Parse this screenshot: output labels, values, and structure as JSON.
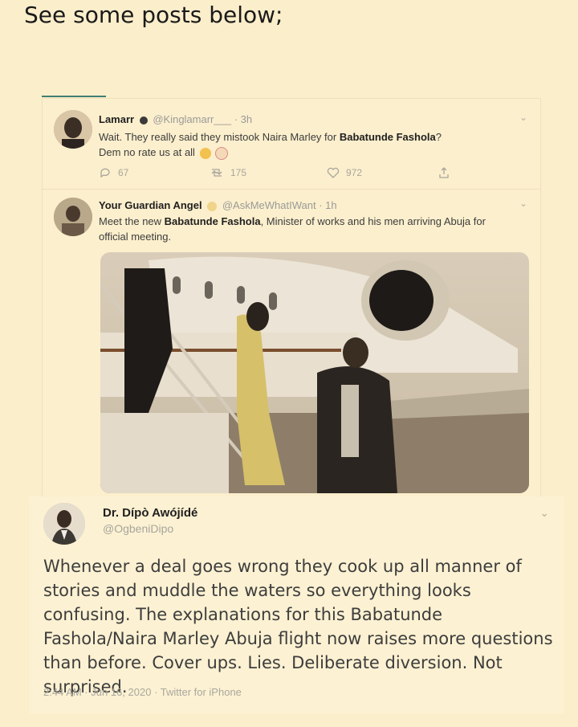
{
  "heading": "See some posts below;",
  "tweet1": {
    "name": "Lamarr",
    "handle": "@Kinglamarr___",
    "time": "· 3h",
    "text_before": "Wait. They really said they mistook Naira Marley for ",
    "text_bold": "Babatunde Fashola",
    "text_after": "?",
    "text_line2": "Dem no rate us at all",
    "reply_count": "67",
    "retweet_count": "175",
    "like_count": "972"
  },
  "tweet2": {
    "name": "Your Guardian Angel",
    "handle": "@AskMeWhatIWant",
    "time": "· 1h",
    "text_before": "Meet the new ",
    "text_bold": "Babatunde Fashola",
    "text_after": ", Minister of works and his men arriving Abuja for official meeting."
  },
  "quote": {
    "name": "Dr. Dípò Awójídé",
    "handle": "@OgbeniDipo",
    "text": "Whenever a deal goes wrong they cook up all manner of stories and muddle the waters so everything looks confusing. The explanations for this Babatunde Fashola/Naira Marley Abuja flight now raises more questions than before. Cover ups. Lies. Deliberate diversion. Not surprised.",
    "meta": "2:44 AM · Jun 16, 2020 · Twitter for iPhone"
  },
  "colors": {
    "background": "#fbeecb",
    "accent": "#3f7f73"
  }
}
